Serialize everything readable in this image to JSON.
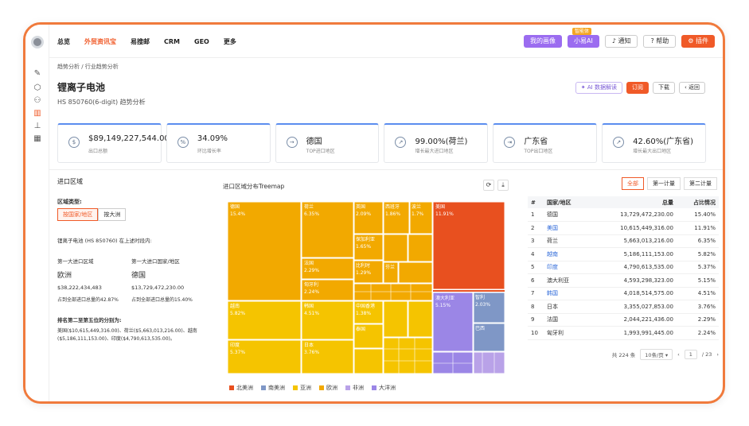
{
  "nav": {
    "items": [
      "总览",
      "外贸资讯宝",
      "易搜邮",
      "CRM",
      "GEO",
      "更多"
    ],
    "active_index": 1
  },
  "topright": {
    "portrait": "我的画像",
    "ai": "小易AI",
    "ai_badge": "智能体",
    "notify": "通知",
    "help": "帮助",
    "plugin": "插件"
  },
  "breadcrumb": "趋势分析 / 行业趋势分析",
  "title": "锂离子电池",
  "subtitle": "HS 850760(6-digit) 趋势分析",
  "actions": {
    "ai": "AI 数据解读",
    "subscribe": "订阅",
    "download": "下载",
    "back": "返回"
  },
  "stats": [
    {
      "value": "$89,149,227,544.00",
      "label": "出口总额",
      "icon": "dollar-icon"
    },
    {
      "value": "34.09%",
      "label": "环比增长率",
      "icon": "growth-icon"
    },
    {
      "value": "德国",
      "label": "TOP进口地区",
      "icon": "import-icon"
    },
    {
      "value": "99.00%(荷兰)",
      "label": "增长最大进口地区",
      "icon": "chart-up-icon"
    },
    {
      "value": "广东省",
      "label": "TOP出口地区",
      "icon": "export-icon"
    },
    {
      "value": "42.60%(广东省)",
      "label": "增长最大出口地区",
      "icon": "chart-up-icon"
    }
  ],
  "left": {
    "section": "进口区域",
    "region_type": "区域类型:",
    "seg": [
      "按国家/地区",
      "按大洲"
    ],
    "intro": "锂离子电池 (HS 850760) 在上述时段内:",
    "col1_label": "第一大进口区域",
    "col2_label": "第一大进口国家/地区",
    "col1_value": "欧洲",
    "col2_value": "德国",
    "col1_amount": "$38,222,434,483",
    "col2_amount": "$13,729,472,230.00",
    "col1_share": "占到全部进口总量的42.87%",
    "col2_share": "占到全部进口总量的15.40%",
    "rank_title": "排名第二至第五位的分别为:",
    "rank_text1": "美国($10,615,449,316.00)、荷兰($5,663,013,216.00)、越南",
    "rank_text2": "($5,186,111,153.00)、印度($4,790,613,535.00)。"
  },
  "treemap": {
    "title": "进口区域分布Treemap",
    "labels": {
      "de": "德国",
      "de_p": "15.4%",
      "nl": "荷兰",
      "nl_p": "6.35%",
      "uk": "英国",
      "uk_p": "2.09%",
      "es": "西班牙",
      "es_p": "1.86%",
      "pl": "波兰",
      "pl_p": "1.7%",
      "bg": "保加利亚",
      "bg_p": "1.65%",
      "fr": "法国",
      "fr_p": "2.29%",
      "be": "比利时",
      "be_p": "1.29%",
      "hu": "匈牙利",
      "hu_p": "2.24%",
      "fi": "芬兰",
      "us": "美国",
      "us_p": "11.91%",
      "vn": "越南",
      "vn_p": "5.82%",
      "kr": "韩国",
      "kr_p": "4.51%",
      "tw": "中国香港",
      "tw_p": "1.38%",
      "th": "泰国",
      "in": "印度",
      "in_p": "5.37%",
      "jp": "日本",
      "jp_p": "3.76%",
      "au": "澳大利亚",
      "au_p": "5.15%",
      "cl": "智利",
      "cl_p": "2.03%",
      "br": "巴西"
    }
  },
  "legend": [
    {
      "name": "北美洲",
      "color": "#e8501f"
    },
    {
      "name": "南美洲",
      "color": "#7f97c6"
    },
    {
      "name": "亚洲",
      "color": "#f5c400"
    },
    {
      "name": "欧洲",
      "color": "#f2a900"
    },
    {
      "name": "非洲",
      "color": "#b9a2e8"
    },
    {
      "name": "大洋洲",
      "color": "#9b86e6"
    }
  ],
  "right": {
    "tabs": [
      "全部",
      "第一计量",
      "第二计量"
    ],
    "headers": [
      "#",
      "国家/地区",
      "总量",
      "占比情况"
    ],
    "rows": [
      {
        "n": "1",
        "c": "德国",
        "v": "13,729,472,230.00",
        "p": "15.40%"
      },
      {
        "n": "2",
        "c": "美国",
        "v": "10,615,449,316.00",
        "p": "11.91%"
      },
      {
        "n": "3",
        "c": "荷兰",
        "v": "5,663,013,216.00",
        "p": "6.35%"
      },
      {
        "n": "4",
        "c": "越南",
        "v": "5,186,111,153.00",
        "p": "5.82%"
      },
      {
        "n": "5",
        "c": "印度",
        "v": "4,790,613,535.00",
        "p": "5.37%"
      },
      {
        "n": "6",
        "c": "澳大利亚",
        "v": "4,593,298,323.00",
        "p": "5.15%"
      },
      {
        "n": "7",
        "c": "韩国",
        "v": "4,018,514,575.00",
        "p": "4.51%"
      },
      {
        "n": "8",
        "c": "日本",
        "v": "3,355,027,853.00",
        "p": "3.76%"
      },
      {
        "n": "9",
        "c": "法国",
        "v": "2,044,221,436.00",
        "p": "2.29%"
      },
      {
        "n": "10",
        "c": "匈牙利",
        "v": "1,993,991,445.00",
        "p": "2.24%"
      }
    ],
    "pager": {
      "total": "共 224 条",
      "size": "10条/页",
      "page": "1",
      "pages": "/ 23"
    }
  }
}
